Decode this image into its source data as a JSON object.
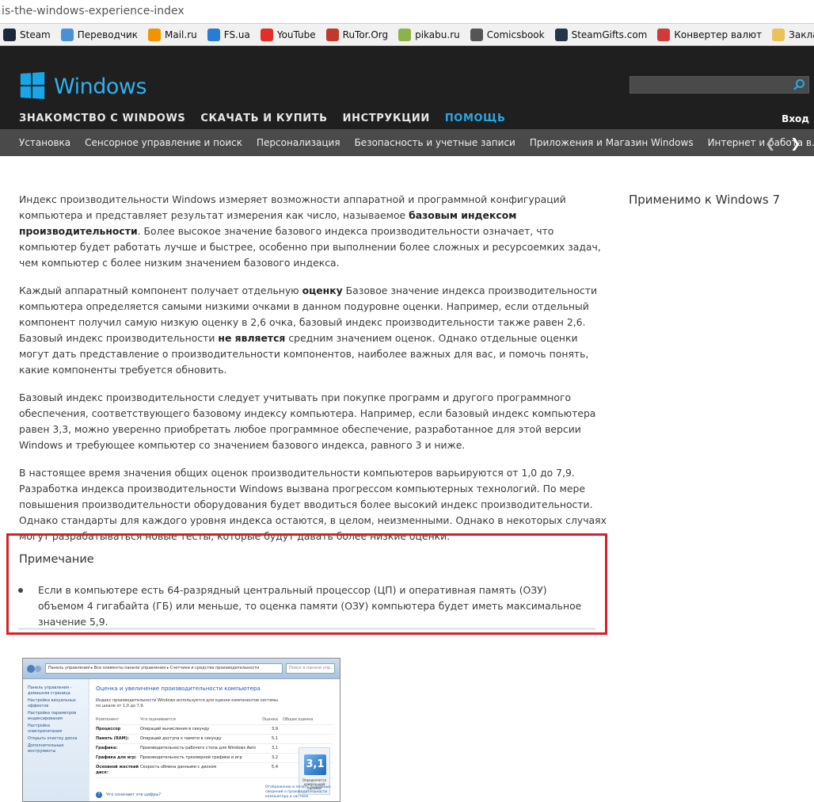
{
  "browser": {
    "url": "is-the-windows-experience-index",
    "bookmarks": [
      {
        "label": "Steam",
        "icon": "steam-icon",
        "color": "#1b2838"
      },
      {
        "label": "Переводчик",
        "icon": "translator-icon",
        "color": "#4a90d9"
      },
      {
        "label": "Mail.ru",
        "icon": "mailru-icon",
        "color": "#f29400"
      },
      {
        "label": "FS.ua",
        "icon": "arrow-up-icon",
        "color": "#2a7bd6"
      },
      {
        "label": "YouTube",
        "icon": "youtube-icon",
        "color": "#e52d27"
      },
      {
        "label": "RuTor.Org",
        "icon": "rutor-icon",
        "color": "#c0392b"
      },
      {
        "label": "pikabu.ru",
        "icon": "pikabu-icon",
        "color": "#8bb34a"
      },
      {
        "label": "Comicsbook",
        "icon": "comics-icon",
        "color": "#555555"
      },
      {
        "label": "SteamGifts.com",
        "icon": "steamgifts-icon",
        "color": "#263447"
      },
      {
        "label": "Конвертер валют",
        "icon": "converter-icon",
        "color": "#d23a3a"
      },
      {
        "label": "Закладки",
        "icon": "folder-icon",
        "color": "#e7c35a"
      }
    ]
  },
  "header": {
    "logo_text": "Windows",
    "nav": [
      {
        "label": "ЗНАКОМСТВО С WINDOWS",
        "active": false
      },
      {
        "label": "СКАЧАТЬ И КУПИТЬ",
        "active": false
      },
      {
        "label": "ИНСТРУКЦИИ",
        "active": false
      },
      {
        "label": "ПОМОЩЬ",
        "active": true
      }
    ],
    "signin": "Вход",
    "accent": "#29a8e5"
  },
  "subnav": [
    "Установка",
    "Сенсорное управление и поиск",
    "Персонализация",
    "Безопасность и учетные записи",
    "Приложения и Магазин Windows",
    "Интернет и работа в..."
  ],
  "sidebar": {
    "applies_to": "Применимо к Windows 7"
  },
  "article": {
    "p1_a": "Индекс производительности Windows измеряет возможности аппаратной и программной конфигураций компьютера и представляет результат измерения как число, называемое ",
    "p1_b": "базовым индексом производительности",
    "p1_c": ". Более высокое значение базового индекса производительности означает, что компьютер будет работать лучше и быстрее, особенно при выполнении более сложных и ресурсоемких задач, чем компьютер с более низким значением базового индекса.",
    "p2_a": "Каждый аппаратный компонент получает отдельную ",
    "p2_b": "оценку",
    "p2_c": " Базовое значение индекса производительности компьютера определяется самыми низкими очками в данном подуровне оценки. Например, если отдельный компонент получил самую низкую оценку в 2,6 очка, базовый индекс производительности также равен 2,6. Базовый индекс производительности ",
    "p2_d": "не является",
    "p2_e": " средним значением оценок. Однако отдельные оценки могут дать представление о производительности компонентов, наиболее важных для вас, и помочь понять, какие компоненты требуется обновить.",
    "p3": "Базовый индекс производительности следует учитывать при покупке программ и другого программного обеспечения, соответствующего базовому индексу компьютера. Например, если базовый индекс компьютера равен 3,3, можно уверенно приобретать любое программное обеспечение, разработанное для этой версии Windows и требующее компьютер со значением базового индекса, равного 3 и ниже.",
    "p4": "В настоящее время значения общих оценок производительности компьютеров варьируются от 1,0 до 7,9. Разработка индекса производительности Windows вызвана прогрессом компьютерных технологий. По мере повышения производительности оборудования будет вводиться более высокий индекс производительности. Однако стандарты для каждого уровня индекса остаются, в целом, неизменными. Однако в некоторых случаях могут разрабатываться новые тесты, которые будут давать более низкие оценки."
  },
  "note": {
    "title": "Примечание",
    "text": "Если в компьютере есть 64-разрядный центральный процессор (ЦП) и оперативная память (ОЗУ) объемом 4 гигабайта (ГБ) или меньше, то оценка памяти (ОЗУ) компьютера будет иметь максимальное значение 5,9.",
    "border_color": "#d62027"
  },
  "screenshot": {
    "address": "Панель управления ▸ Все элементы панели управления ▸ Счетчики и средства производительности",
    "search": "Поиск в панели упр...",
    "left_links": [
      "Панель управления - домашняя страница",
      "Настройка визуальных эффектов",
      "Настройка параметров индексирования",
      "Настройка электропитания",
      "Открыть очистку диска",
      "Дополнительные инструменты"
    ],
    "title": "Оценка и увеличение производительности компьютера",
    "desc": "Индекс производительности Windows используется для оценки компонентов системы по шкале от 1,0 до 7,9.",
    "headers": [
      "Компонент",
      "Что оценивается",
      "Оценка",
      "Общая оценка"
    ],
    "rows": [
      {
        "c": "Процессор",
        "w": "Операций вычисления в секунду",
        "s": "3,9"
      },
      {
        "c": "Память (RAM):",
        "w": "Операций доступа к памяти в секунду",
        "s": "5,1"
      },
      {
        "c": "Графика:",
        "w": "Производительность рабочего стола для Windows Aero",
        "s": "3,1"
      },
      {
        "c": "Графика для игр:",
        "w": "Производительность трехмерной графики и игр",
        "s": "3,2"
      },
      {
        "c": "Основной жесткий диск:",
        "w": "Скорость обмена данными с диском",
        "s": "5,4"
      }
    ],
    "score": "3,1",
    "score_caption": "Определяется наименьшей оценкой",
    "footer_link": "Что означают эти цифры?",
    "footer_right": "Отображение и печать подробных сведений о производительности компьютера и системе"
  }
}
